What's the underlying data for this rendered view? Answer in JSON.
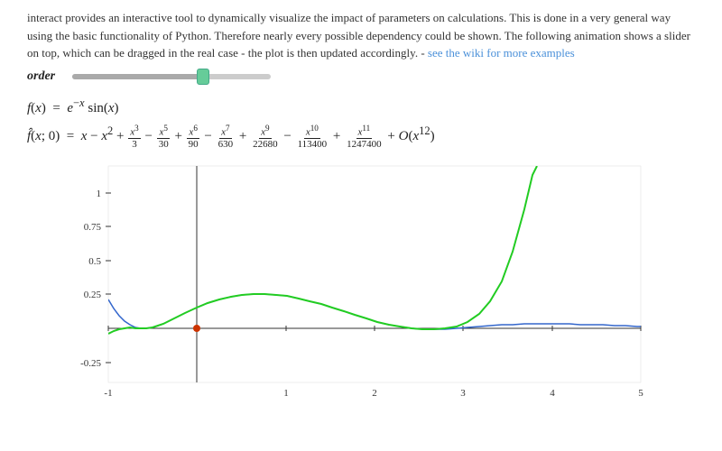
{
  "intro": {
    "text": "interact provides an interactive tool to dynamically visualize the impact of parameters on calculations. This is done in a very general way using the basic functionality of Python. Therefore nearly every possible dependency could be shown. The following animation shows a slider on top, which can be dragged in the real case - the plot is then updated accordingly. -",
    "link_text": "see the wiki for more examples",
    "link_url": "#"
  },
  "slider": {
    "label": "order",
    "min": 0,
    "max": 12,
    "value": 11,
    "fill_percent": 68
  },
  "formula": {
    "fx": "f(x) = e⁻ˣ sin(x)",
    "fhat": "f̂(x; 0)"
  },
  "chart": {
    "x_min": -1,
    "x_max": 5,
    "y_min": -0.25,
    "y_max": 1.0,
    "x_ticks": [
      -1,
      1,
      2,
      3,
      4,
      5
    ],
    "y_ticks": [
      1,
      0.75,
      0.5,
      0.25,
      -0.25
    ]
  },
  "colors": {
    "green_curve": "#22cc22",
    "blue_curve": "#3366cc",
    "dot": "#cc3300",
    "axis": "#333"
  }
}
